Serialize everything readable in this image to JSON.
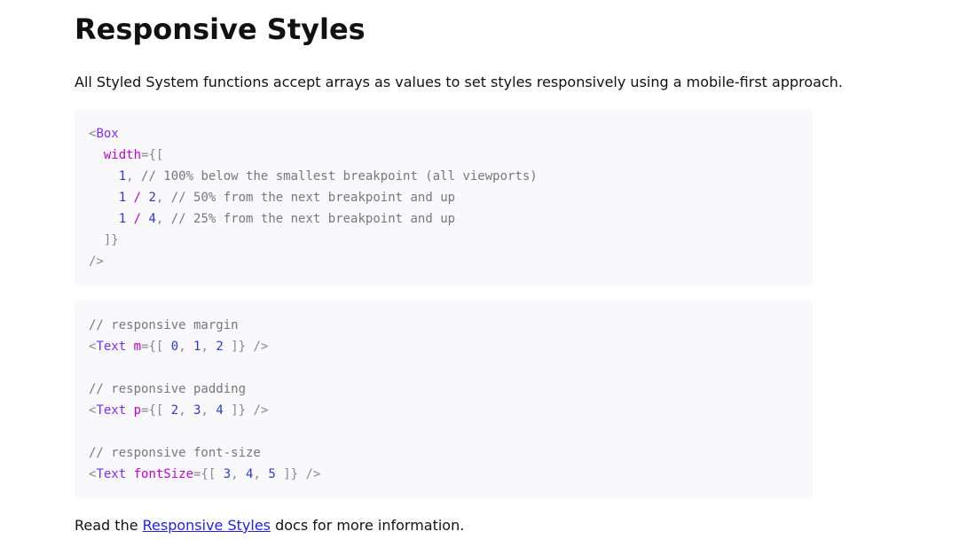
{
  "page": {
    "title": "Responsive Styles",
    "intro": "All Styled System functions accept arrays as values to set styles responsively using a mobile-first approach.",
    "read_prefix": "Read the ",
    "read_link": "Responsive Styles",
    "read_suffix": " docs for more information."
  },
  "code_block_1": {
    "tag": "Box",
    "prop": "width",
    "rows": [
      {
        "a": "1",
        "b": "",
        "comment": "// 100% below the smallest breakpoint (all viewports)"
      },
      {
        "a": "1",
        "b": "2",
        "comment": "// 50% from the next breakpoint and up"
      },
      {
        "a": "1",
        "b": "4",
        "comment": "// 25% from the next breakpoint and up"
      }
    ]
  },
  "code_block_2": {
    "examples": [
      {
        "comment": "// responsive margin",
        "tag": "Text",
        "prop": "m",
        "values": [
          "0",
          "1",
          "2"
        ]
      },
      {
        "comment": "// responsive padding",
        "tag": "Text",
        "prop": "p",
        "values": [
          "2",
          "3",
          "4"
        ]
      },
      {
        "comment": "// responsive font-size",
        "tag": "Text",
        "prop": "fontSize",
        "values": [
          "3",
          "4",
          "5"
        ]
      }
    ]
  },
  "colors": {
    "tag": "#7b2bf9",
    "attr": "#c200d4",
    "number": "#2f39c9",
    "comment": "#777777",
    "link": "#1f1ff0",
    "code_bg": "#f9f9fb"
  }
}
